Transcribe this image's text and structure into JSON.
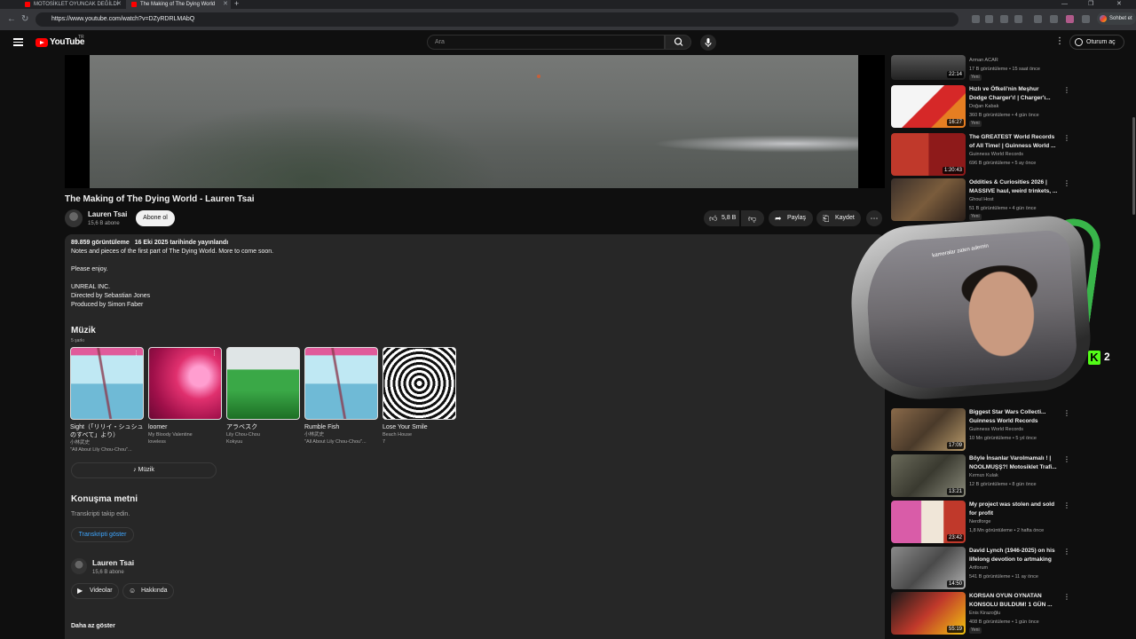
{
  "browser": {
    "tabs": [
      {
        "title": "MOTOSİKLET OYUNCAK DEĞİLDİ"
      },
      {
        "title": "The Making of The Dying World"
      }
    ],
    "url": "https://www.youtube.com/watch?v=DZyRDRLMAbQ",
    "chat_button": "Sohbet et"
  },
  "header": {
    "logo_text": "YouTube",
    "logo_region": "TR",
    "search_placeholder": "Ara",
    "signin_label": "Oturum aç"
  },
  "video": {
    "title": "The Making of The Dying World - Lauren Tsai",
    "channel": "Lauren Tsai",
    "subscribers": "15,6 B abone",
    "subscribe_label": "Abone ol",
    "like_count": "5,8 B",
    "share_label": "Paylaş",
    "save_label": "Kaydet"
  },
  "description": {
    "views": "89.859 görüntüleme",
    "date": "16 Eki 2025 tarihinde yayınlandı",
    "line1": "Notes and pieces of the first part of The Dying World. More to come soon.",
    "line2": "Please enjoy.",
    "line3": "UNREAL INC.",
    "line4": "Directed by Sebastian Jones",
    "line5": "Produced by Simon Faber"
  },
  "music": {
    "heading": "Müzik",
    "count": "5 şarkı",
    "songs": [
      {
        "title": "Sight（「リリイ・シュシュのすべて」より）",
        "artist": "小林武史",
        "album": "\"All About Lily Chou-Chou\"..."
      },
      {
        "title": "loomer",
        "artist": "My Bloody Valentine",
        "album": "loveless"
      },
      {
        "title": "アラベスク",
        "artist": "Lily Chou-Chou",
        "album": "Kokyuu"
      },
      {
        "title": "Rumble Fish",
        "artist": "小林武史",
        "album": "\"All About Lily Chou-Chou\"..."
      },
      {
        "title": "Lose Your Smile",
        "artist": "Beach House",
        "album": "7"
      }
    ],
    "button_label": "Müzik"
  },
  "transcript": {
    "heading": "Konuşma metni",
    "sub": "Transkripti takip edin.",
    "button_label": "Transkripti göster"
  },
  "channel_section": {
    "name": "Lauren Tsai",
    "subs": "15,6 B abone",
    "videos_label": "Videolar",
    "about_label": "Hakkında",
    "show_less": "Daha az göster"
  },
  "recommendations": [
    {
      "title": "",
      "channel": "Arman ACAR",
      "meta": "17 B görüntüleme • 15 saat önce",
      "badge": "Yeni",
      "duration": "22:14"
    },
    {
      "title": "Hızlı ve Öfkeli'nin Meşhur Dodge Charger'ı! | Charger'ı...",
      "channel": "Doğan Kabak",
      "meta": "360 B görüntüleme • 4 gün önce",
      "badge": "Yeni",
      "duration": "16:27"
    },
    {
      "title": "The GREATEST World Records of All Time! | Guinness World ...",
      "channel": "Guinness World Records",
      "meta": "696 B görüntüleme • 5 ay önce",
      "badge": "",
      "duration": "1:20:43"
    },
    {
      "title": "Oddities & Curiosities 2026 | MASSIVE haul, weird trinkets, ...",
      "channel": "Ghoul Host",
      "meta": "51 B görüntüleme • 4 gün önce",
      "badge": "Yeni",
      "duration": ""
    },
    {
      "title": "Biggest Star Wars Collecti... Guinness World Records",
      "channel": "Guinness World Records",
      "meta": "10 Mn görüntüleme • 5 yıl önce",
      "badge": "",
      "duration": "17:09"
    },
    {
      "title": "Böyle İnsanlar Varolmamalı ! | NOOLMUŞŞ?! Motosiklet Trafi...",
      "channel": "Kırmızı Kulak",
      "meta": "12 B görüntüleme • 8 gün önce",
      "badge": "",
      "duration": "13:21"
    },
    {
      "title": "My project was stolen and sold for profit",
      "channel": "Nerdforge",
      "meta": "1,8 Mn görüntüleme • 2 hafta önce",
      "badge": "",
      "duration": "23:42"
    },
    {
      "title": "David Lynch (1946-2025) on his lifelong devotion to artmaking ...",
      "channel": "Artforum",
      "meta": "541 B görüntüleme • 11 ay önce",
      "badge": "",
      "duration": "14:50"
    },
    {
      "title": "KORSAN OYUN OYNATAN KONSOLU BULDUM! 1 GÜN ...",
      "channel": "Enis Kirazoğlu",
      "meta": "408 B görüntüleme • 1 gün önce",
      "badge": "Yeni",
      "duration": "55:19"
    }
  ],
  "overlay": {
    "caption": "kameralar zaten ademin",
    "kick_letter": "K",
    "kick_count": "2"
  },
  "colors": {
    "background": "#0f0f0f",
    "accent_red": "#ff0000",
    "link_blue": "#3ea6ff",
    "kick_green": "#53fc18"
  }
}
